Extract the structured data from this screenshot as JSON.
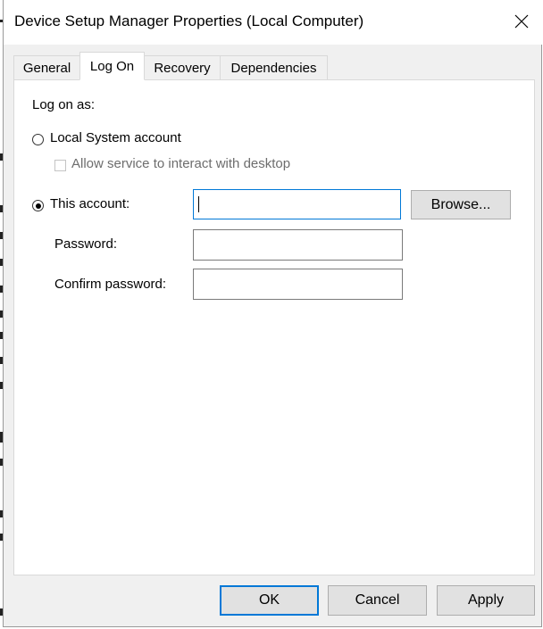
{
  "window": {
    "title": "Device Setup Manager Properties (Local Computer)",
    "close_icon": "close-icon"
  },
  "tabs": [
    {
      "label": "General",
      "active": false
    },
    {
      "label": "Log On",
      "active": true
    },
    {
      "label": "Recovery",
      "active": false
    },
    {
      "label": "Dependencies",
      "active": false
    }
  ],
  "logon": {
    "heading": "Log on as:",
    "local_system_label": "Local System account",
    "local_system_selected": false,
    "interact_desktop_label": "Allow service to interact with desktop",
    "interact_desktop_checked": false,
    "this_account_label": "This account:",
    "this_account_selected": true,
    "account_value": "",
    "browse_label": "Browse...",
    "password_label": "Password:",
    "password_value": "",
    "confirm_password_label": "Confirm password:",
    "confirm_password_value": ""
  },
  "buttons": {
    "ok": "OK",
    "cancel": "Cancel",
    "apply": "Apply"
  },
  "colors": {
    "focus_accent": "#0078d7",
    "dialog_bg": "#f0f0f0",
    "panel_bg": "#ffffff"
  }
}
